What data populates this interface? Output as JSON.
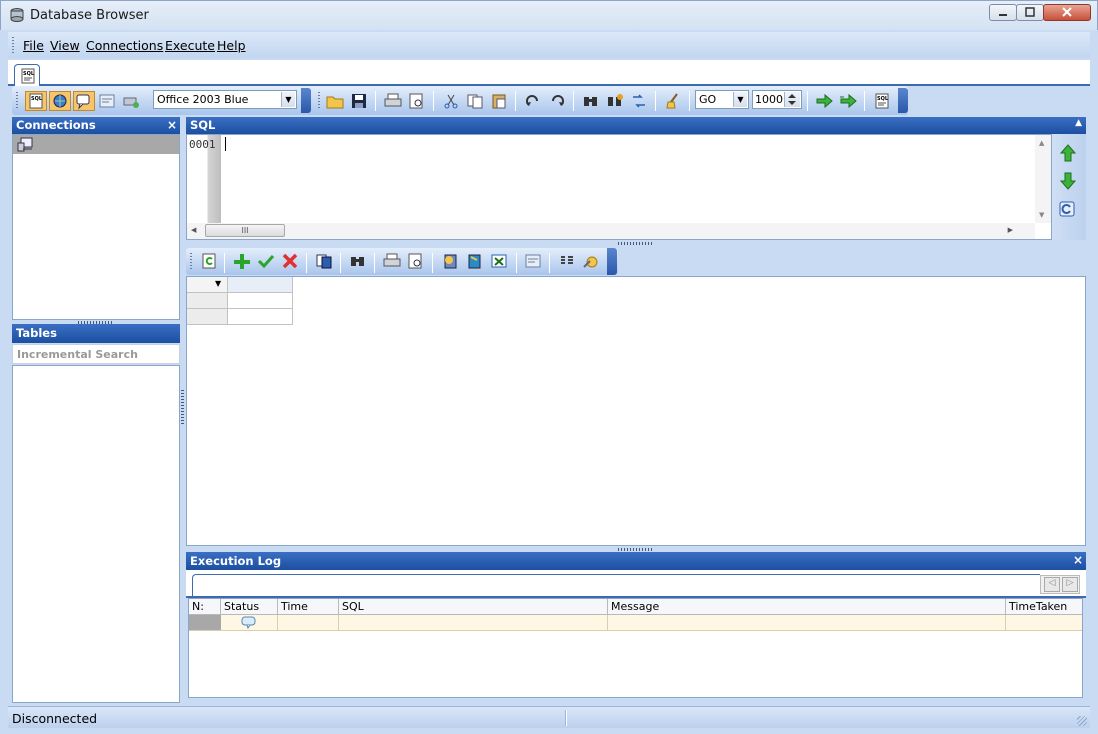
{
  "window": {
    "title": "Database Browser"
  },
  "menu": [
    "File",
    "View",
    "Connections",
    "Execute",
    "Help"
  ],
  "toolbar": {
    "theme_value": "Office 2003 Blue",
    "terminator_value": "GO",
    "row_limit_value": "1000"
  },
  "connections_panel": {
    "title": "Connections"
  },
  "tables_panel": {
    "title": "Tables",
    "search_placeholder": "Incremental Search"
  },
  "sql_panel": {
    "title": "SQL",
    "line_number": "0001",
    "scroll_marker": "III"
  },
  "log_panel": {
    "title": "Execution Log",
    "columns": [
      "N:",
      "Status",
      "Time",
      "SQL",
      "Message",
      "TimeTaken"
    ]
  },
  "status": {
    "text": "Disconnected"
  },
  "colors": {
    "panel_header": "#1c4fa0",
    "accent_green": "#2aa52a",
    "accent_red": "#e03030"
  }
}
